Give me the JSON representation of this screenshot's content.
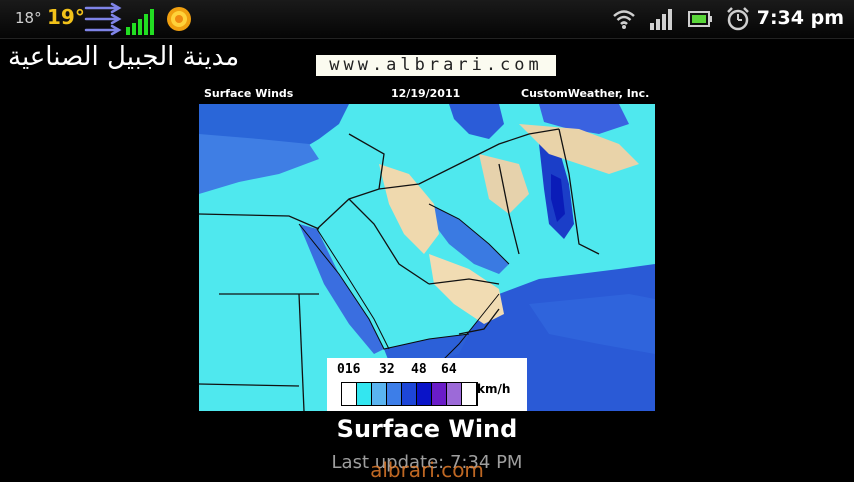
{
  "status_bar": {
    "temp_low": "18°",
    "temp_high": "19°",
    "clock": "7:34 pm",
    "icons": [
      "wind-arrows-icon",
      "signal-bars-icon",
      "sun-icon",
      "wifi-icon",
      "cell-signal-icon",
      "battery-icon",
      "alarm-clock-icon"
    ],
    "colors": {
      "temp_high": "#f2c21a",
      "bars": "#22dd22"
    }
  },
  "header": {
    "city_name": "مدينة الجبيل الصناعية",
    "site_banner": "www.albrari.com"
  },
  "map": {
    "label_left": "Surface Winds",
    "label_date": "12/19/2011",
    "label_right": "CustomWeather, Inc.",
    "legend": {
      "ticks": [
        "016",
        "32",
        "48",
        "64"
      ],
      "unit": "km/h",
      "colors": [
        "#ffffff",
        "#33e6f0",
        "#5ab4f0",
        "#3d7ee8",
        "#1d46d8",
        "#0a14c8",
        "#6a1cc8",
        "#9c6ad8",
        "#ffffff"
      ]
    }
  },
  "title": "Surface Wind",
  "last_update": "Last update: 7:34 PM",
  "watermark": "albrari.com"
}
